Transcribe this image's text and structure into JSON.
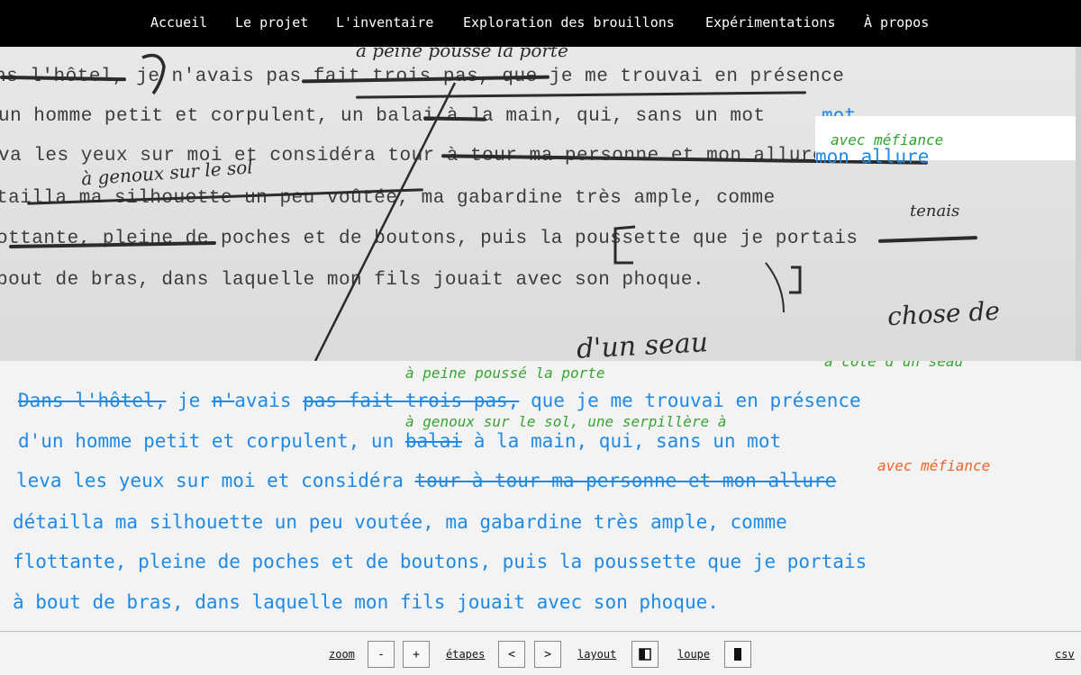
{
  "nav": {
    "items": [
      {
        "label": "Accueil"
      },
      {
        "label": "Le projet"
      },
      {
        "label": "L'inventaire"
      },
      {
        "label": "Exploration des brouillons"
      },
      {
        "label": "Expérimentations"
      },
      {
        "label": "À propos"
      }
    ]
  },
  "scan": {
    "lines": [
      "ns l'hôtel, je n'avais pas fait trois pas, que je me trouvai en présence",
      "un homme petit et corpulent, un balai à la main, qui, sans un mot",
      "va les yeux sur moi et considéra tour à tour ma personne et mon allure",
      "tailla ma silhouette un peu voûtée, ma gabardine très ample, comme",
      "ottante, pleine de poches et de boutons, puis la poussette que je portais",
      "bout de bras, dans laquelle mon fils jouait avec son phoque."
    ],
    "handwriting": [
      "à peine poussé la porte",
      "à genoux sur le sol",
      "tenais",
      "chose de",
      "d'un seau"
    ],
    "overlay_word_mot": "mot",
    "overlay_allure": "mon allure",
    "overlay_green": "avec méfiance"
  },
  "transcript": {
    "insert_top": "à peine poussé la porte",
    "line1": {
      "strike1": "Dans l'hôtel,",
      "mid1": " je ",
      "strike2": "n'",
      "mid2": "avais ",
      "strike3": "pas fait trois pas,",
      "rest": " que je me trouvai en présence"
    },
    "insert_mid": "à genoux sur le sol,  une serpillère à",
    "insert_top_right": "à côté d'un seau",
    "line2": {
      "a": "d'un homme petit et corpulent, un ",
      "strike": "balai",
      "b": " à la main, qui, sans un mot"
    },
    "line3": {
      "a": "leva les yeux sur moi et considéra ",
      "strike": "tour à tour ma personne et mon allure"
    },
    "insert_orange": "avec méfiance",
    "line4": "détailla ma silhouette un peu voutée, ma gabardine très ample, comme",
    "line5": "flottante, pleine de poches et de boutons, puis la poussette que je portais",
    "line6": "à bout de bras, dans laquelle mon fils jouait avec son phoque."
  },
  "toolbar": {
    "zoom_label": "zoom",
    "zoom_minus": "-",
    "zoom_plus": "+",
    "etapes_label": "étapes",
    "prev": "<",
    "next": ">",
    "layout_label": "layout",
    "layout_icon": "split-layout-icon",
    "loupe_label": "loupe",
    "loupe_icon": "loupe-bar-icon",
    "csv_label": "csv"
  },
  "colors": {
    "transcript_blue": "#1f8ae6",
    "insert_green": "#36a531",
    "insert_orange": "#f0632a",
    "nav_bg": "#000000"
  }
}
